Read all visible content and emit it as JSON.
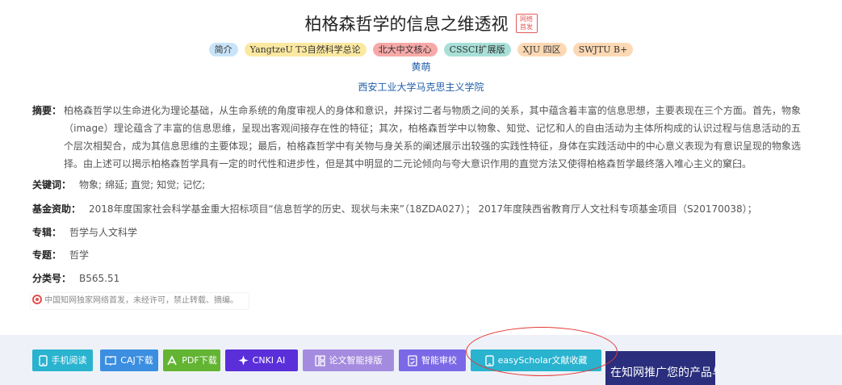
{
  "article": {
    "title": "柏格森哲学的信息之维透视",
    "first_publish_badge": "网络首发",
    "tags": [
      {
        "label": "简介",
        "bg": "#c9e4f8"
      },
      {
        "label": "YangtzeU T3自然科学总论",
        "bg": "#fbe9a1"
      },
      {
        "label": "北大中文核心",
        "bg": "#f7a9a8"
      },
      {
        "label": "CSSCI扩展版",
        "bg": "#a8e0d8"
      },
      {
        "label": "XJU 四区",
        "bg": "#fcd9b4"
      },
      {
        "label": "SWJTU B+",
        "bg": "#fcd9b4"
      }
    ],
    "author": "黄萌",
    "organization": "西安工业大学马克思主义学院",
    "abstract_label": "摘要：",
    "abstract": "柏格森哲学以生命进化为理论基础，从生命系统的角度审视人的身体和意识，并探讨二者与物质之间的关系，其中蕴含着丰富的信息思想，主要表现在三个方面。首先，物象（image）理论蕴含了丰富的信息思维，呈现出客观间接存在性的特征；其次，柏格森哲学中以物象、知觉、记忆和人的自由活动为主体所构成的认识过程与信息活动的五个层次相契合，成为其信息思维的主要体现；最后，柏格森哲学中有关物与身关系的阐述展示出较强的实践性特征，身体在实践活动中的中心意义表现为有意识呈现的物象选择。由上述可以揭示柏格森哲学具有一定的时代性和进步性，但是其中明显的二元论倾向与夸大意识作用的直觉方法又使得柏格森哲学最终落入唯心主义的窠臼。",
    "keywords_label": "关键词：",
    "keywords": [
      "物象;",
      "绵延;",
      "直觉;",
      "知觉;",
      "记忆;"
    ],
    "fund_label": "基金资助：",
    "fund": "2018年度国家社会科学基金重大招标项目“信息哲学的历史、现状与未来”（18ZDA027）；  2017年度陕西省教育厅人文社科专项基金项目（S20170038）；",
    "series_label": "专辑：",
    "series": "哲学与人文科学",
    "topic_label": "专题：",
    "topic": "哲学",
    "classification_label": "分类号：",
    "classification": "B565.51",
    "notice": "中国知网独家网络首发，未经许可，禁止转载、摘编。"
  },
  "toolbar": {
    "buttons": [
      {
        "label": "手机阅读",
        "icon": "phone-icon",
        "color": "#29b3cf"
      },
      {
        "label": "CAJ下载",
        "icon": "book-icon",
        "color": "#3b8ee0"
      },
      {
        "label": "PDF下载",
        "icon": "pdf-icon",
        "color": "#62b432"
      },
      {
        "label": "CNKI AI",
        "icon": "ai-sparkle-icon",
        "color": "#5a2fd9"
      },
      {
        "label": "论文智能排版",
        "icon": "layout-icon",
        "color": "#a58be0"
      },
      {
        "label": "智能审校",
        "icon": "review-icon",
        "color": "#7b68e6"
      },
      {
        "label": "easyScholar文献收藏",
        "icon": "phone-icon",
        "color": "#29b3cf"
      }
    ],
    "promo": "在知网推广您的产品与服务?"
  },
  "annotation": {
    "color": "#e53935"
  }
}
